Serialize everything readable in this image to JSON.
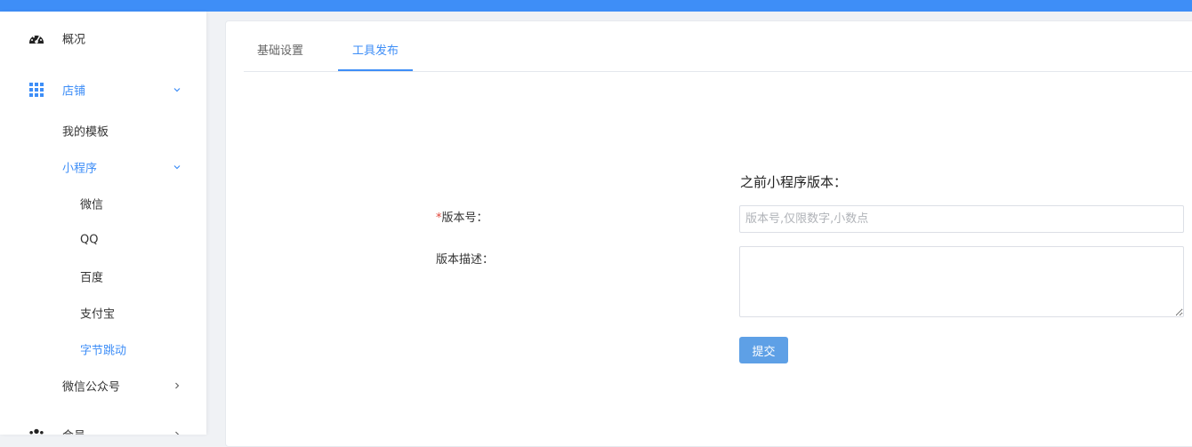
{
  "sidebar": {
    "items": [
      {
        "label": "概况",
        "icon": "dashboard-icon"
      },
      {
        "label": "店铺",
        "icon": "grid-icon"
      },
      {
        "label": "我的模板"
      },
      {
        "label": "小程序"
      },
      {
        "label": "微信"
      },
      {
        "label": "QQ"
      },
      {
        "label": "百度"
      },
      {
        "label": "支付宝"
      },
      {
        "label": "字节跳动"
      },
      {
        "label": "微信公众号"
      },
      {
        "label": "会员",
        "icon": "users-icon"
      }
    ]
  },
  "tabs": [
    {
      "label": "基础设置",
      "selected": false
    },
    {
      "label": "工具发布",
      "selected": true
    }
  ],
  "form": {
    "prev_version_label": "之前小程序版本：",
    "required_mark": "*",
    "version_label": "版本号：",
    "version_value": "",
    "version_placeholder": "版本号,仅限数字,小数点",
    "desc_label": "版本描述：",
    "desc_value": "",
    "submit_label": "提交"
  },
  "colors": {
    "accent": "#3e8ef7",
    "button": "#5ea0e6",
    "required": "#e0463a"
  }
}
